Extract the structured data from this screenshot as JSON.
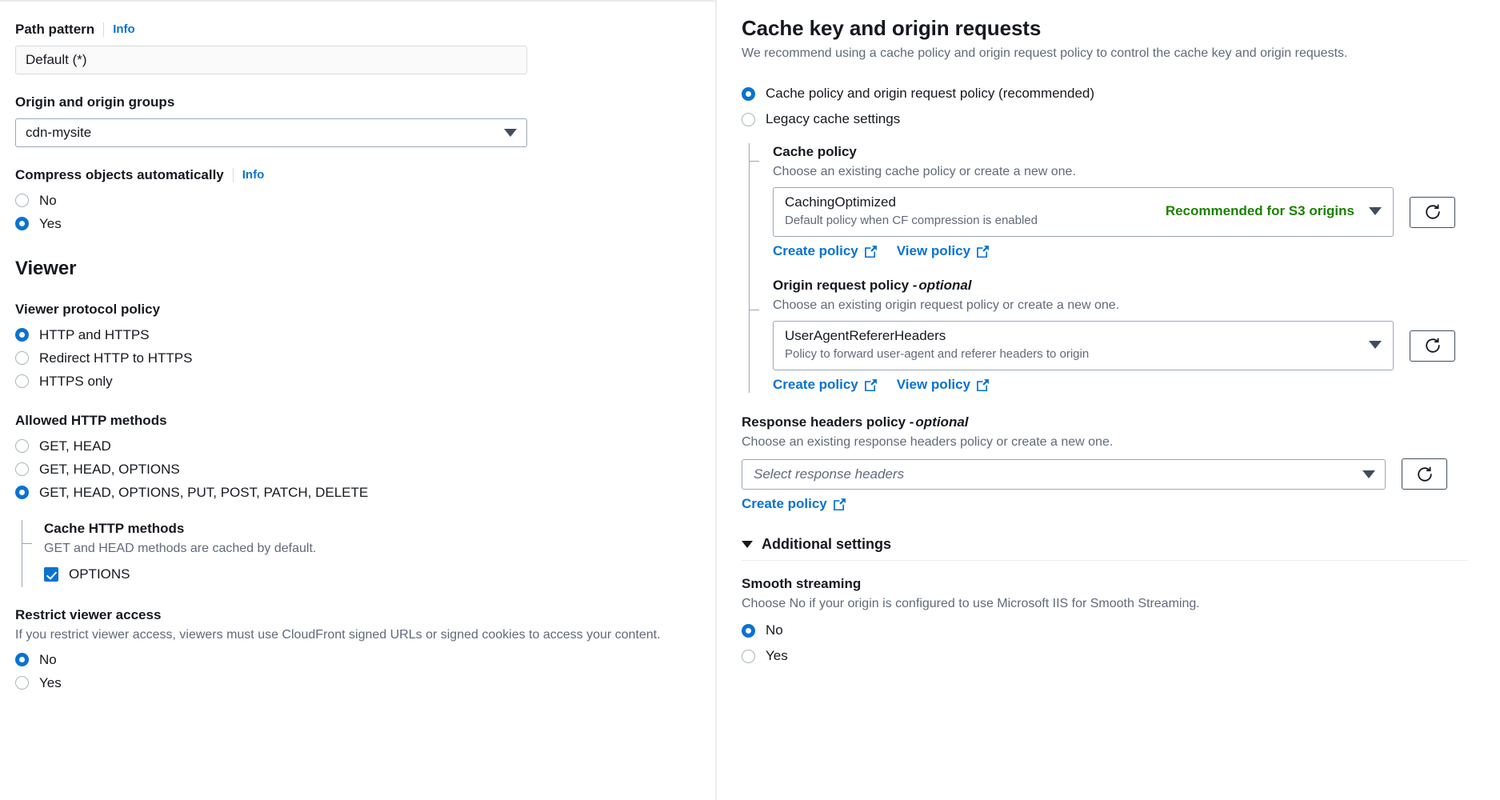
{
  "left": {
    "path_pattern": {
      "label": "Path pattern",
      "info": "Info",
      "value": "Default (*)"
    },
    "origin": {
      "label": "Origin and origin groups",
      "value": "cdn-mysite"
    },
    "compress": {
      "label": "Compress objects automatically",
      "info": "Info",
      "options": [
        {
          "label": "No",
          "checked": false
        },
        {
          "label": "Yes",
          "checked": true
        }
      ]
    },
    "viewer_section_title": "Viewer",
    "viewer_protocol": {
      "label": "Viewer protocol policy",
      "options": [
        {
          "label": "HTTP and HTTPS",
          "checked": true
        },
        {
          "label": "Redirect HTTP to HTTPS",
          "checked": false
        },
        {
          "label": "HTTPS only",
          "checked": false
        }
      ]
    },
    "allowed_methods": {
      "label": "Allowed HTTP methods",
      "options": [
        {
          "label": "GET, HEAD",
          "checked": false
        },
        {
          "label": "GET, HEAD, OPTIONS",
          "checked": false
        },
        {
          "label": "GET, HEAD, OPTIONS, PUT, POST, PATCH, DELETE",
          "checked": true
        }
      ]
    },
    "cache_methods": {
      "label": "Cache HTTP methods",
      "desc": "GET and HEAD methods are cached by default.",
      "option": {
        "label": "OPTIONS",
        "checked": true
      }
    },
    "restrict_viewer": {
      "label": "Restrict viewer access",
      "desc": "If you restrict viewer access, viewers must use CloudFront signed URLs or signed cookies to access your content.",
      "options": [
        {
          "label": "No",
          "checked": true
        },
        {
          "label": "Yes",
          "checked": false
        }
      ]
    }
  },
  "right": {
    "title": "Cache key and origin requests",
    "subtitle": "We recommend using a cache policy and origin request policy to control the cache key and origin requests.",
    "mode_options": [
      {
        "label": "Cache policy and origin request policy (recommended)",
        "checked": true
      },
      {
        "label": "Legacy cache settings",
        "checked": false
      }
    ],
    "cache_policy": {
      "label": "Cache policy",
      "desc": "Choose an existing cache policy or create a new one.",
      "selected_name": "CachingOptimized",
      "selected_sub": "Default policy when CF compression is enabled",
      "badge": "Recommended for S3 origins",
      "badge_color": "#1d8102",
      "links": [
        {
          "label": "Create policy"
        },
        {
          "label": "View policy"
        }
      ]
    },
    "origin_request_policy": {
      "label": "Origin request policy - ",
      "label_optional": "optional",
      "desc": "Choose an existing origin request policy or create a new one.",
      "selected_name": "UserAgentRefererHeaders",
      "selected_sub": "Policy to forward user-agent and referer headers to origin",
      "links": [
        {
          "label": "Create policy"
        },
        {
          "label": "View policy"
        }
      ]
    },
    "response_headers_policy": {
      "label": "Response headers policy - ",
      "label_optional": "optional",
      "desc": "Choose an existing response headers policy or create a new one.",
      "placeholder": "Select response headers",
      "links": [
        {
          "label": "Create policy"
        }
      ]
    },
    "additional_settings": {
      "label": "Additional settings"
    },
    "smooth_streaming": {
      "label": "Smooth streaming",
      "desc": "Choose No if your origin is configured to use Microsoft IIS for Smooth Streaming.",
      "options": [
        {
          "label": "No",
          "checked": true
        },
        {
          "label": "Yes",
          "checked": false
        }
      ]
    }
  }
}
